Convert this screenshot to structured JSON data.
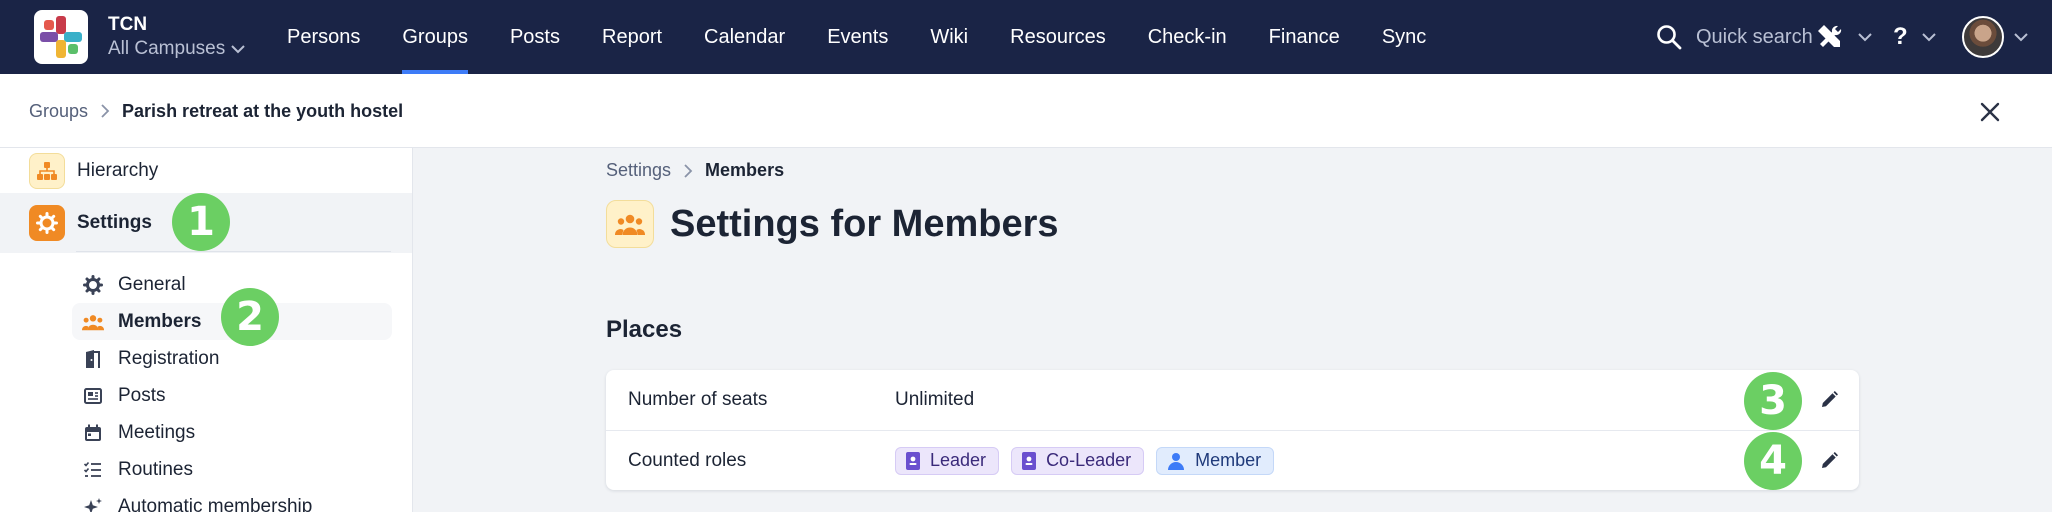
{
  "app": {
    "org_name": "TCN",
    "campus_selector": "All Campuses"
  },
  "nav": {
    "items": [
      "Persons",
      "Groups",
      "Posts",
      "Report",
      "Calendar",
      "Events",
      "Wiki",
      "Resources",
      "Check-in",
      "Finance",
      "Sync"
    ],
    "active": "Groups"
  },
  "top_right": {
    "search_placeholder": "Quick search",
    "help_label": "?"
  },
  "breadcrumb": {
    "parent": "Groups",
    "current": "Parish retreat at the youth hostel"
  },
  "sidebar": {
    "hierarchy_label": "Hierarchy",
    "settings_label": "Settings",
    "sub_items": [
      {
        "label": "General",
        "icon": "gear-icon"
      },
      {
        "label": "Members",
        "icon": "people-icon",
        "active": true
      },
      {
        "label": "Registration",
        "icon": "door-icon"
      },
      {
        "label": "Posts",
        "icon": "newspaper-icon"
      },
      {
        "label": "Meetings",
        "icon": "calendar-icon"
      },
      {
        "label": "Routines",
        "icon": "checklist-icon"
      },
      {
        "label": "Automatic membership",
        "icon": "sparkle-icon"
      }
    ]
  },
  "main": {
    "breadcrumb_parent": "Settings",
    "breadcrumb_current": "Members",
    "title": "Settings for Members",
    "section_title": "Places",
    "rows": [
      {
        "label": "Number of seats",
        "value": "Unlimited"
      },
      {
        "label": "Counted roles",
        "roles": [
          "Leader",
          "Co-Leader",
          "Member"
        ]
      }
    ]
  },
  "callouts": [
    "1",
    "2",
    "3",
    "4"
  ],
  "colors": {
    "topbar": "#1a2446",
    "active_underline": "#3d7bf7",
    "settings_tile": "#f08a24",
    "callout": "#6bcf63",
    "role_leader_chip": "#ece6fb",
    "role_member_chip": "#e1ecfd"
  }
}
